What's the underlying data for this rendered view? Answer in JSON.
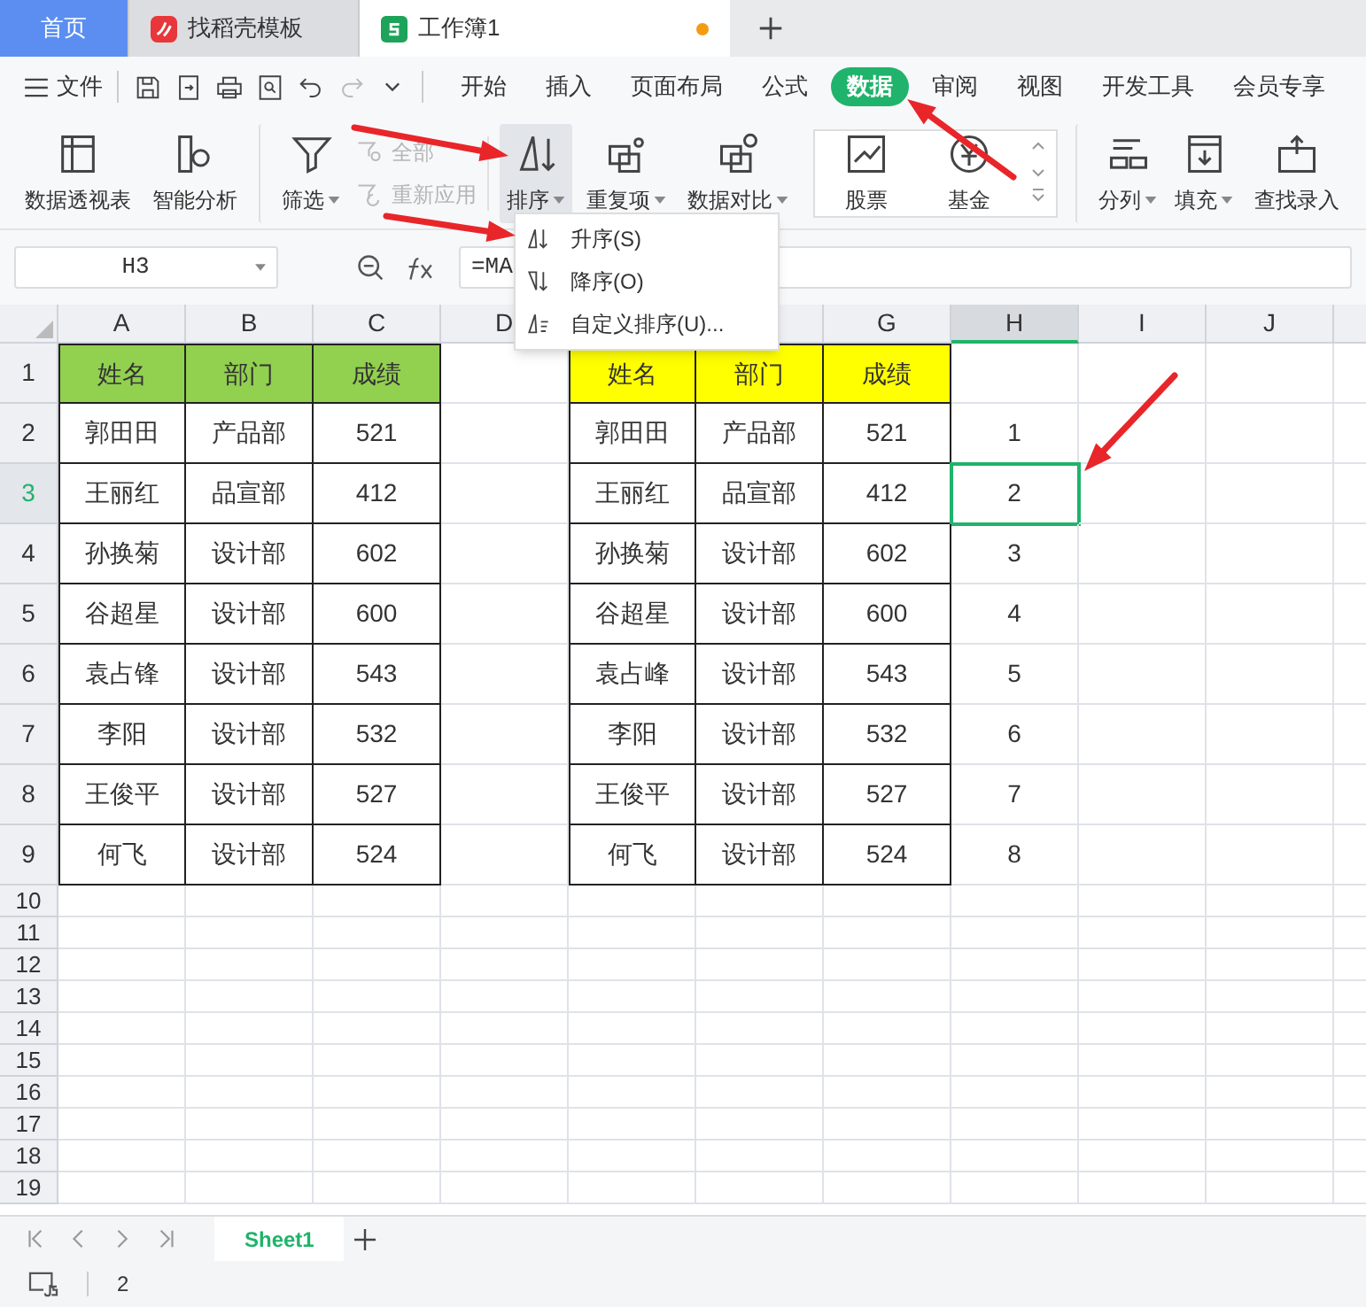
{
  "doc_tabs": [
    {
      "label": "首页",
      "kind": "home",
      "selected": false
    },
    {
      "label": "找稻壳模板",
      "kind": "template",
      "selected": false
    },
    {
      "label": "工作簿1",
      "kind": "sheet",
      "selected": true,
      "unsaved": true
    }
  ],
  "file_menu": "文件",
  "menu_tabs": [
    {
      "label": "开始",
      "selected": false
    },
    {
      "label": "插入",
      "selected": false
    },
    {
      "label": "页面布局",
      "selected": false
    },
    {
      "label": "公式",
      "selected": false
    },
    {
      "label": "数据",
      "selected": true
    },
    {
      "label": "审阅",
      "selected": false
    },
    {
      "label": "视图",
      "selected": false
    },
    {
      "label": "开发工具",
      "selected": false
    },
    {
      "label": "会员专享",
      "selected": false
    }
  ],
  "ribbon": [
    {
      "label": "数据透视表",
      "kind": "big"
    },
    {
      "label": "智能分析",
      "kind": "big"
    },
    {
      "label": "筛选",
      "kind": "big",
      "dropdown": true
    },
    {
      "kind": "stack",
      "items": [
        {
          "label": "全部",
          "disabled": true
        },
        {
          "label": "重新应用",
          "disabled": true
        }
      ]
    },
    {
      "label": "排序",
      "kind": "big",
      "dropdown": true,
      "pressed": true
    },
    {
      "label": "重复项",
      "kind": "big",
      "dropdown": true
    },
    {
      "label": "数据对比",
      "kind": "big",
      "dropdown": true
    },
    {
      "kind": "gallery",
      "items": [
        {
          "label": "股票"
        },
        {
          "label": "基金"
        }
      ]
    },
    {
      "label": "分列",
      "kind": "big",
      "dropdown": true
    },
    {
      "label": "填充",
      "kind": "big",
      "dropdown": true
    },
    {
      "label": "查找录入",
      "kind": "big"
    }
  ],
  "sort_menu": [
    {
      "label": "升序(S)"
    },
    {
      "label": "降序(O)"
    },
    {
      "label": "自定义排序(U)..."
    }
  ],
  "name_box": "H3",
  "formula": "=MA",
  "columns": [
    {
      "label": "A",
      "selected": false
    },
    {
      "label": "B",
      "selected": false
    },
    {
      "label": "C",
      "selected": false
    },
    {
      "label": "D",
      "selected": false
    },
    {},
    {},
    {
      "label": "G",
      "selected": false
    },
    {
      "label": "H",
      "selected": true
    },
    {
      "label": "I",
      "selected": false
    },
    {
      "label": "J",
      "selected": false
    }
  ],
  "row_numbers": [
    {
      "label": "1",
      "selected": false
    },
    {
      "label": "2",
      "selected": false
    },
    {
      "label": "3",
      "selected": true
    },
    {
      "label": "4",
      "selected": false
    },
    {
      "label": "5",
      "selected": false
    },
    {
      "label": "6",
      "selected": false
    },
    {
      "label": "7",
      "selected": false
    },
    {
      "label": "8",
      "selected": false
    },
    {
      "label": "9",
      "selected": false
    },
    {
      "label": "10",
      "selected": false
    },
    {
      "label": "11",
      "selected": false
    },
    {
      "label": "12",
      "selected": false
    },
    {
      "label": "13",
      "selected": false
    },
    {
      "label": "14",
      "selected": false
    },
    {
      "label": "15",
      "selected": false
    },
    {
      "label": "16",
      "selected": false
    },
    {
      "label": "17",
      "selected": false
    },
    {
      "label": "18",
      "selected": false
    },
    {
      "label": "19",
      "selected": false
    }
  ],
  "tables": [
    {
      "headers": [
        "姓名",
        "部门",
        "成绩"
      ],
      "rows": [
        [
          "郭田田",
          "产品部",
          "521"
        ],
        [
          "王丽红",
          "品宣部",
          "412"
        ],
        [
          "孙换菊",
          "设计部",
          "602"
        ],
        [
          "谷超星",
          "设计部",
          "600"
        ],
        [
          "袁占锋",
          "设计部",
          "543"
        ],
        [
          "李阳",
          "设计部",
          "532"
        ],
        [
          "王俊平",
          "设计部",
          "527"
        ],
        [
          "何飞",
          "设计部",
          "524"
        ]
      ]
    },
    {
      "headers": [
        "姓名",
        "部门",
        "成绩"
      ],
      "rows": [
        [
          "郭田田",
          "产品部",
          "521"
        ],
        [
          "王丽红",
          "品宣部",
          "412"
        ],
        [
          "孙换菊",
          "设计部",
          "602"
        ],
        [
          "谷超星",
          "设计部",
          "600"
        ],
        [
          "袁占峰",
          "设计部",
          "543"
        ],
        [
          "李阳",
          "设计部",
          "532"
        ],
        [
          "王俊平",
          "设计部",
          "527"
        ],
        [
          "何飞",
          "设计部",
          "524"
        ]
      ]
    }
  ],
  "rank_column": [
    {
      "value": "1",
      "selected": false
    },
    {
      "value": "2",
      "selected": true
    },
    {
      "value": "3",
      "selected": false
    },
    {
      "value": "4",
      "selected": false
    },
    {
      "value": "5",
      "selected": false
    },
    {
      "value": "6",
      "selected": false
    },
    {
      "value": "7",
      "selected": false
    },
    {
      "value": "8",
      "selected": false
    }
  ],
  "sheet_tabs": [
    {
      "label": "Sheet1",
      "selected": true
    }
  ],
  "status_bar": {
    "value": "2"
  }
}
